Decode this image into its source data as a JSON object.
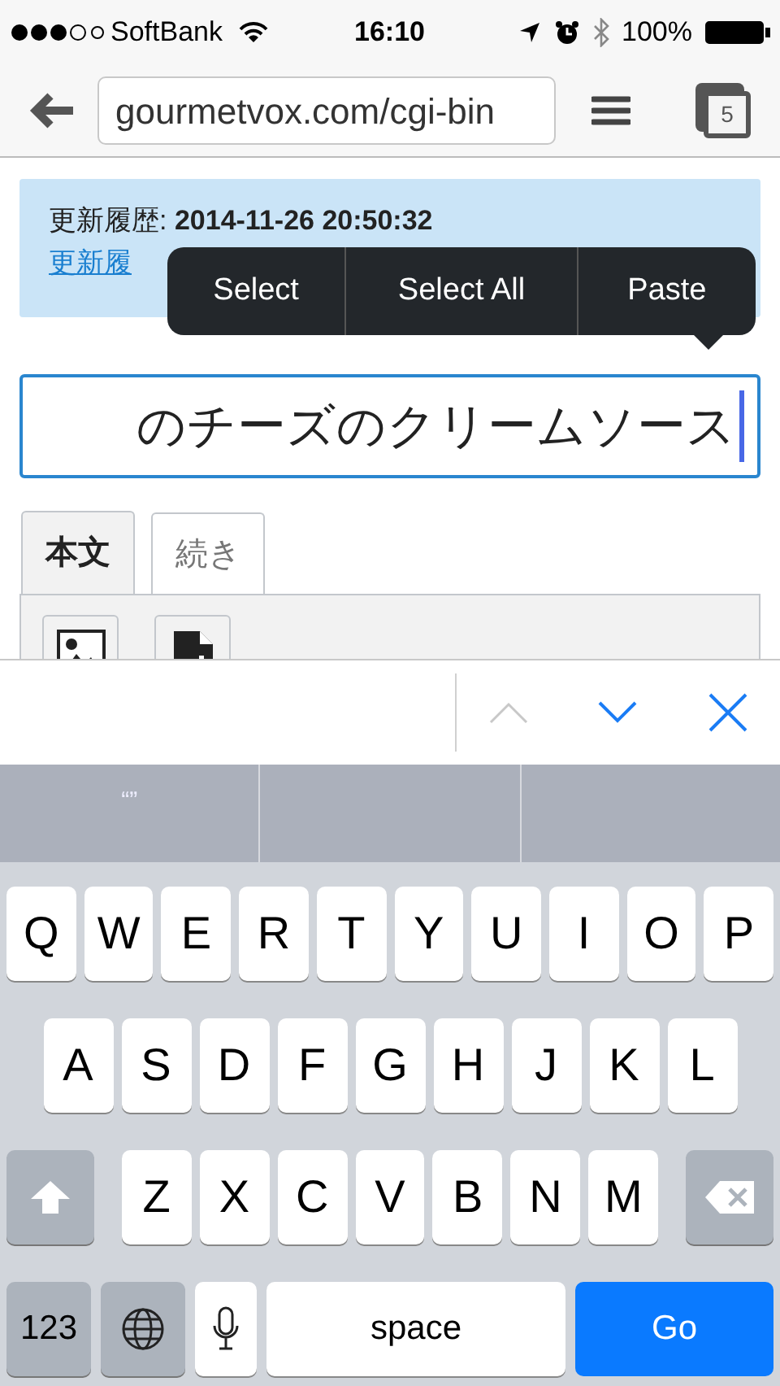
{
  "status_bar": {
    "carrier": "SoftBank",
    "time": "16:10",
    "battery": "100%"
  },
  "browser": {
    "url": "gourmetvox.com/cgi-bin",
    "tab_count": "5"
  },
  "notice": {
    "label": "更新履歴: ",
    "timestamp": "2014-11-26 20:50:32",
    "link": "更新履"
  },
  "edit_menu": [
    "Select",
    "Select All",
    "Paste"
  ],
  "title_field": {
    "value": "のチーズのクリームソース"
  },
  "tabs": [
    {
      "label": "本文",
      "selected": true
    },
    {
      "label": "続き",
      "selected": false
    }
  ],
  "form_nav": {
    "previous_disabled": true
  },
  "suggestion_bar": {
    "suggestion": "“”"
  },
  "keyboard": {
    "rows": [
      [
        "Q",
        "W",
        "E",
        "R",
        "T",
        "Y",
        "U",
        "I",
        "O",
        "P"
      ],
      [
        "A",
        "S",
        "D",
        "F",
        "G",
        "H",
        "J",
        "K",
        "L"
      ],
      [
        "Z",
        "X",
        "C",
        "V",
        "B",
        "N",
        "M"
      ]
    ],
    "numbers": "123",
    "space": "space",
    "go": "Go"
  }
}
